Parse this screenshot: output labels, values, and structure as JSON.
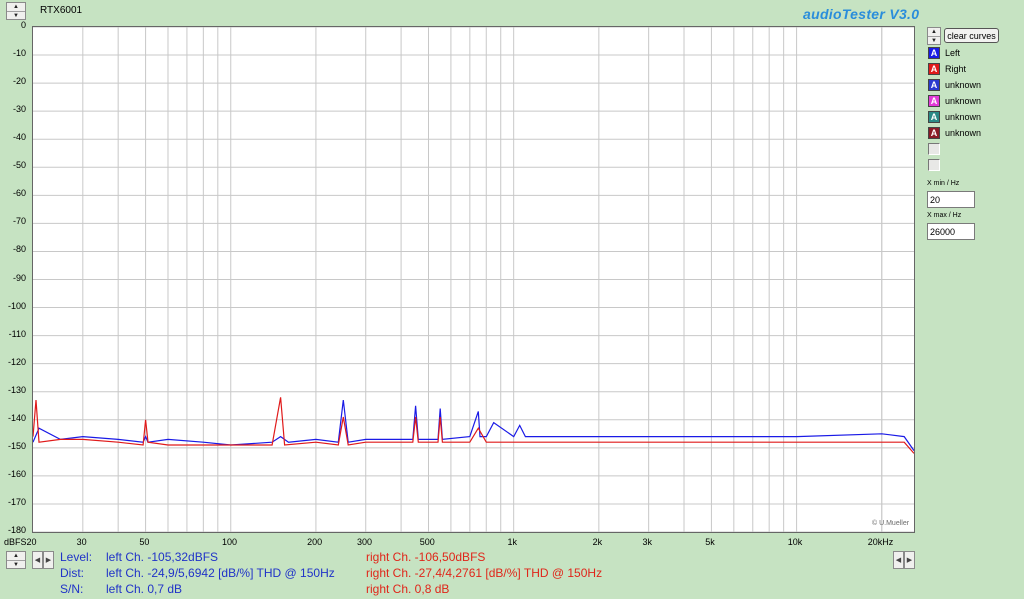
{
  "window": {
    "device_name": "RTX6001",
    "app_title": "audioTester  V3.0"
  },
  "toolbar": {
    "clear_curves_label": "clear curves"
  },
  "chart_data": {
    "type": "line",
    "x_scale": "log",
    "xlim": [
      20,
      26000
    ],
    "ylim": [
      -180,
      0
    ],
    "yticks": [
      0,
      -10,
      -20,
      -30,
      -40,
      -50,
      -60,
      -70,
      -80,
      -90,
      -100,
      -110,
      -120,
      -130,
      -140,
      -150,
      -160,
      -170,
      -180
    ],
    "ytick_labels": [
      "0",
      "-10",
      "-20",
      "-30",
      "-40",
      "-50",
      "-60",
      "-70",
      "-80",
      "-90",
      "-100",
      "-110",
      "-120",
      "-130",
      "-140",
      "-150",
      "-160",
      "-170",
      "-180"
    ],
    "xticks": [
      20,
      30,
      50,
      100,
      200,
      300,
      500,
      1000,
      2000,
      3000,
      5000,
      10000,
      20000
    ],
    "xtick_labels": [
      "dBFS20",
      "30",
      "50",
      "100",
      "200",
      "300",
      "500",
      "1k",
      "2k",
      "3k",
      "5k",
      "10k",
      "20kHz"
    ],
    "grid": true,
    "series": [
      {
        "name": "Left",
        "color": "#1a1ae6",
        "x": [
          20,
          21,
          25,
          30,
          40,
          49,
          50,
          51,
          60,
          80,
          100,
          140,
          150,
          160,
          200,
          240,
          250,
          260,
          300,
          440,
          450,
          460,
          540,
          550,
          560,
          700,
          750,
          760,
          800,
          850,
          1000,
          1050,
          1100,
          1500,
          2000,
          3000,
          5000,
          10000,
          20000,
          24000,
          26000
        ],
        "y": [
          -148,
          -143,
          -147,
          -146,
          -147,
          -148,
          -146,
          -148,
          -147,
          -148,
          -149,
          -148,
          -146,
          -148,
          -147,
          -148,
          -133,
          -148,
          -147,
          -147,
          -135,
          -147,
          -147,
          -136,
          -147,
          -146,
          -137,
          -146,
          -146,
          -141,
          -146,
          -142,
          -146,
          -146,
          -146,
          -146,
          -146,
          -146,
          -145,
          -146,
          -151
        ]
      },
      {
        "name": "Right",
        "color": "#e01a1a",
        "x": [
          20,
          20.5,
          21,
          25,
          30,
          40,
          49,
          50,
          51,
          60,
          100,
          140,
          150,
          155,
          200,
          240,
          250,
          260,
          300,
          440,
          450,
          460,
          540,
          550,
          560,
          700,
          750,
          800,
          1000,
          1500,
          2000,
          3000,
          5000,
          10000,
          20000,
          24000,
          26000
        ],
        "y": [
          -146,
          -133,
          -148,
          -147,
          -147,
          -148,
          -149,
          -140,
          -148,
          -149,
          -149,
          -149,
          -132,
          -149,
          -148,
          -149,
          -139,
          -149,
          -148,
          -148,
          -139,
          -148,
          -148,
          -139,
          -148,
          -148,
          -143,
          -148,
          -148,
          -148,
          -148,
          -148,
          -148,
          -148,
          -148,
          -148,
          -152
        ]
      }
    ]
  },
  "legend": [
    {
      "label": "Left",
      "color": "#1a1ae6",
      "glyph": "A"
    },
    {
      "label": "Right",
      "color": "#e01a1a",
      "glyph": "A"
    },
    {
      "label": "unknown",
      "color": "#2a3ad0",
      "glyph": "A"
    },
    {
      "label": "unknown",
      "color": "#e23ad8",
      "glyph": "A"
    },
    {
      "label": "unknown",
      "color": "#2a8a86",
      "glyph": "A"
    },
    {
      "label": "unknown",
      "color": "#8a1a26",
      "glyph": "A"
    }
  ],
  "controls": {
    "xmin_label": "X min / Hz",
    "xmin_value": "20",
    "xmax_label": "X max / Hz",
    "xmax_value": "26000"
  },
  "watermark": "© U.Mueller",
  "status": {
    "level_label": "Level:",
    "level_left": "left Ch. -105,32dBFS",
    "level_right": "right Ch. -106,50dBFS",
    "dist_label": "Dist:",
    "dist_left": "left Ch. -24,9/5,6942 [dB/%] THD @ 150Hz",
    "dist_right": "right Ch. -27,4/4,2761 [dB/%] THD @ 150Hz",
    "sn_label": "S/N:",
    "sn_left": "left Ch. 0,7 dB",
    "sn_right": "right Ch. 0,8 dB"
  },
  "icons": {
    "spin_up": "▲",
    "spin_down": "▼",
    "arrow_left": "◀",
    "arrow_right": "▶"
  }
}
